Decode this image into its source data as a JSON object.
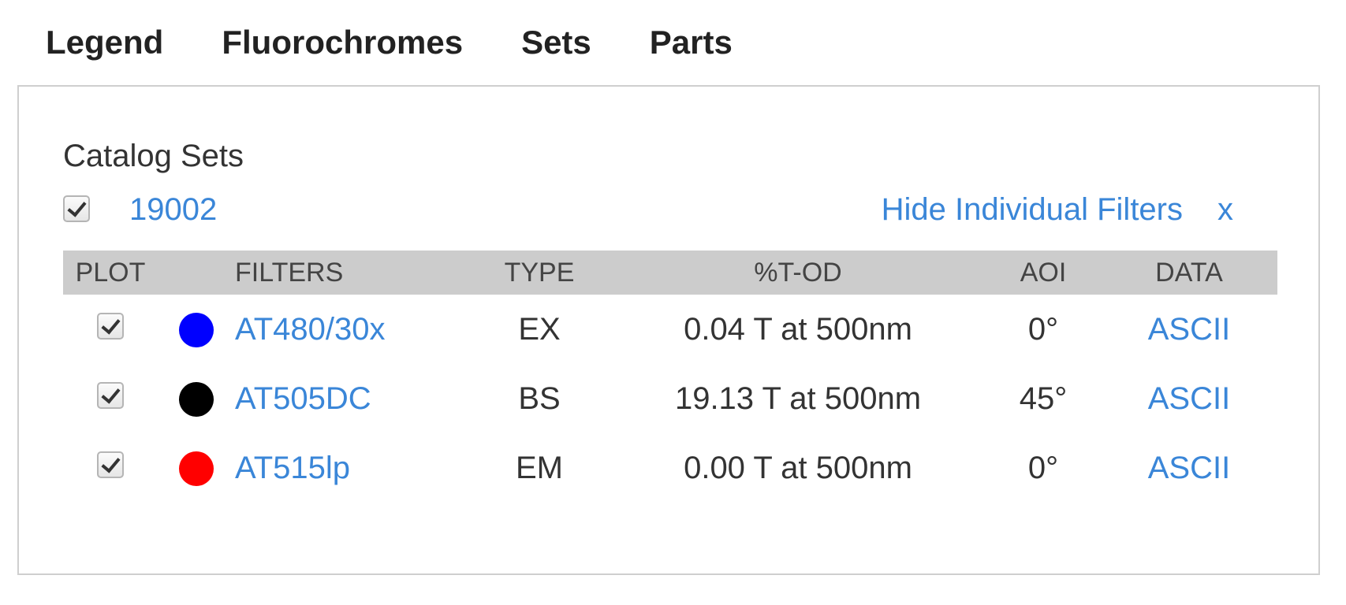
{
  "tabs": [
    {
      "label": "Legend"
    },
    {
      "label": "Fluorochromes"
    },
    {
      "label": "Sets"
    },
    {
      "label": "Parts"
    }
  ],
  "catalog": {
    "title": "Catalog Sets",
    "set_name": "19002",
    "set_checked": true,
    "hide_link": "Hide Individual Filters",
    "close_label": "x"
  },
  "table": {
    "headers": {
      "plot": "PLOT",
      "filters": "FILTERS",
      "type": "TYPE",
      "tod": "%T-OD",
      "aoi": "AOI",
      "data": "DATA"
    },
    "rows": [
      {
        "checked": true,
        "color": "#0000ff",
        "filter": "AT480/30x",
        "type": "EX",
        "tod": "0.04 T at 500nm",
        "aoi": "0°",
        "data": "ASCII"
      },
      {
        "checked": true,
        "color": "#000000",
        "filter": "AT505DC",
        "type": "BS",
        "tod": "19.13 T at 500nm",
        "aoi": "45°",
        "data": "ASCII"
      },
      {
        "checked": true,
        "color": "#ff0000",
        "filter": "AT515lp",
        "type": "EM",
        "tod": "0.00 T at 500nm",
        "aoi": "0°",
        "data": "ASCII"
      }
    ]
  },
  "colors": {
    "link": "#3a86d8",
    "header_bg": "#cccccc",
    "panel_border": "#cfcfcf"
  }
}
